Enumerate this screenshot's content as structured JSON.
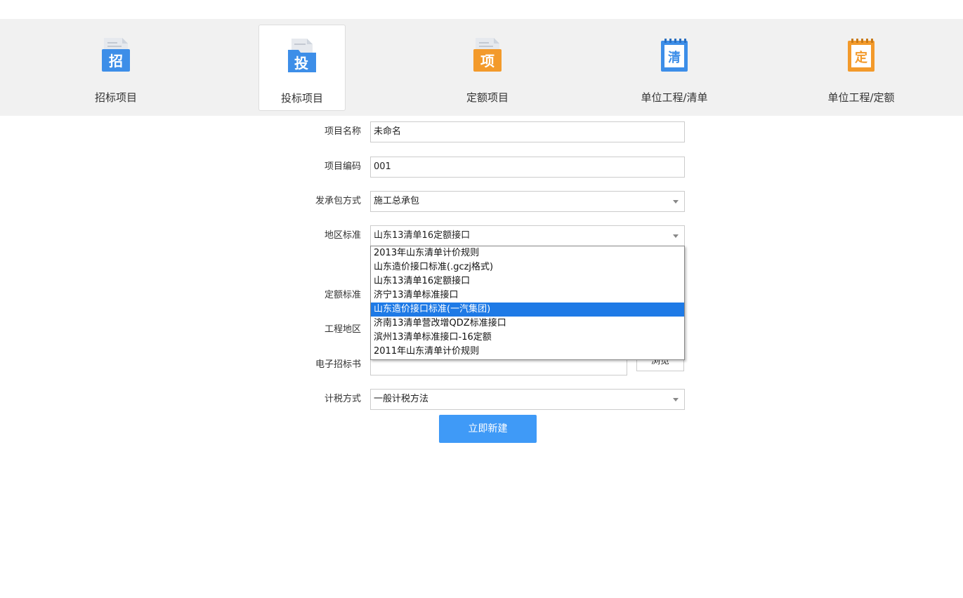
{
  "tabs": [
    {
      "label": "招标项目",
      "icon_char": "招",
      "icon": "zhaobiao-doc-icon",
      "color": "#3d8ee8",
      "active": false
    },
    {
      "label": "投标项目",
      "icon_char": "投",
      "icon": "toubiao-folder-icon",
      "color": "#3d8ee8",
      "active": true
    },
    {
      "label": "定额项目",
      "icon_char": "项",
      "icon": "dinge-doc-icon",
      "color": "#f39a2b",
      "active": false
    },
    {
      "label": "单位工程/清单",
      "icon_char": "清",
      "icon": "qingdan-notepad-icon",
      "color": "#3d8ee8",
      "active": false
    },
    {
      "label": "单位工程/定额",
      "icon_char": "定",
      "icon": "dinge-notepad-icon",
      "color": "#f39a2b",
      "active": false
    }
  ],
  "form": {
    "project_name": {
      "label": "项目名称",
      "value": "未命名"
    },
    "project_code": {
      "label": "项目编码",
      "value": "001"
    },
    "contract_mode": {
      "label": "发承包方式",
      "value": "施工总承包"
    },
    "region_standard": {
      "label": "地区标准",
      "value": "山东13清单16定额接口",
      "options": [
        "2013年山东清单计价规则",
        "山东造价接口标准(.gczj格式)",
        "山东13清单16定额接口",
        "济宁13清单标准接口",
        "山东造价接口标准(一汽集团)",
        "济南13清单营改增QDZ标准接口",
        "滨州13清单标准接口-16定额",
        "2011年山东清单计价规则"
      ],
      "highlighted_index": 4
    },
    "quota_standard": {
      "label": "定额标准"
    },
    "project_region": {
      "label": "工程地区"
    },
    "e_tender": {
      "label": "电子招标书",
      "value": "",
      "browse_label": "浏览"
    },
    "tax_method": {
      "label": "计税方式",
      "value": "一般计税方法"
    },
    "create_button": "立即新建"
  },
  "colors": {
    "accent": "#3f9af7",
    "selection": "#1e7ae6",
    "orange": "#f39a2b",
    "blue": "#3d8ee8"
  }
}
